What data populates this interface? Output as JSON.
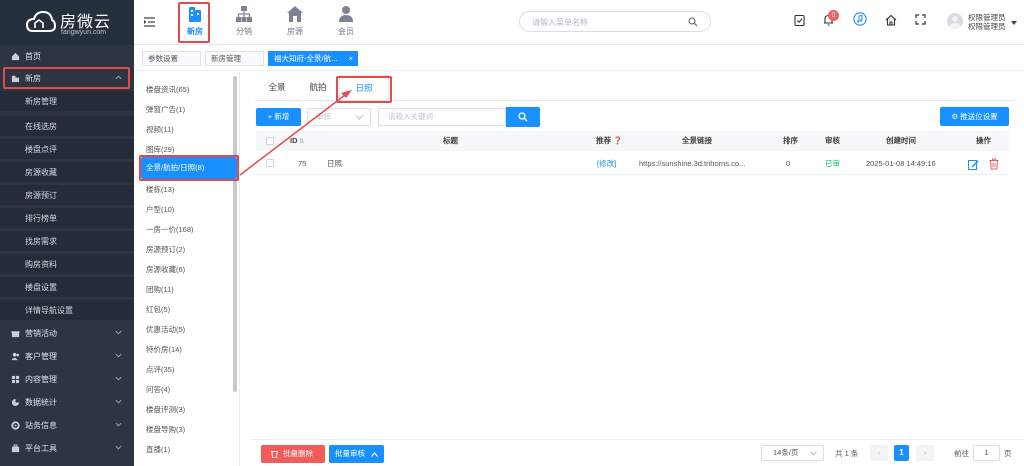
{
  "brand": {
    "name": "房微云",
    "domain": "fangwyun.com"
  },
  "sidebar": {
    "items": [
      {
        "label": "首页",
        "icon": "home-icon"
      },
      {
        "label": "新房",
        "icon": "building-icon",
        "expanded": true
      },
      {
        "label": "营销活动",
        "icon": "gift-icon"
      },
      {
        "label": "客户管理",
        "icon": "people-icon"
      },
      {
        "label": "内容管理",
        "icon": "grid-icon"
      },
      {
        "label": "数据统计",
        "icon": "chart-icon"
      },
      {
        "label": "站务信息",
        "icon": "gear-icon"
      },
      {
        "label": "平台工具",
        "icon": "toolbox-icon"
      }
    ],
    "subitems": [
      "新房管理",
      "在线选房",
      "楼盘点评",
      "房源收藏",
      "房源预订",
      "排行榜单",
      "找房需求",
      "购房资料",
      "楼盘设置",
      "详情导航设置"
    ]
  },
  "topnav": {
    "items": [
      {
        "label": "新房",
        "icon": "building-icon",
        "active": true
      },
      {
        "label": "分销",
        "icon": "org-chart-icon"
      },
      {
        "label": "房源",
        "icon": "house-icon"
      },
      {
        "label": "会员",
        "icon": "member-icon"
      }
    ],
    "search_placeholder": "请输入菜单名称",
    "notification_count": "0",
    "user": {
      "name": "权限管理员",
      "role": "权限管理员"
    }
  },
  "tags": [
    {
      "label": "参数设置",
      "active": false
    },
    {
      "label": "新房管理",
      "active": false
    },
    {
      "label": "福大知府-全景/航...",
      "active": true
    }
  ],
  "categories": [
    "楼盘资讯(65)",
    "弹窗广告(1)",
    "视频(11)",
    "图库(29)",
    "全景/航拍/日照(8)",
    "楼栋(13)",
    "户型(10)",
    "一房一价(168)",
    "房源预订(2)",
    "房源收藏(6)",
    "团购(11)",
    "红包(5)",
    "优惠活动(5)",
    "特价房(14)",
    "点评(35)",
    "问答(4)",
    "楼盘评测(3)",
    "楼盘导购(3)",
    "直播(1)"
  ],
  "active_category_index": 4,
  "tabs": [
    {
      "label": "全景"
    },
    {
      "label": "航拍"
    },
    {
      "label": "日照",
      "active": true
    }
  ],
  "toolbar": {
    "add_label": "+ 新增",
    "review_placeholder": "审核",
    "keyword_placeholder": "请输入关键词",
    "push_label": "推送位设置"
  },
  "table": {
    "headers": {
      "id": "ID",
      "title": "标题",
      "recommend": "推荐",
      "link": "全景链接",
      "sort": "排序",
      "review": "审核",
      "created": "创建时间",
      "actions": "操作"
    },
    "rows": [
      {
        "id": "75",
        "title": "日照",
        "recommend": "[修改]",
        "link": "https://sunshine.3d.trihorns.co...",
        "sort": "0",
        "review": "已审",
        "created": "2025-01-08 14:49:16"
      }
    ]
  },
  "footer": {
    "batch_delete": "批量删除",
    "batch_review": "批量审核",
    "page_size": "14条/页",
    "total": "共 1 条",
    "current_page": "1",
    "goto_label": "前往",
    "goto_value": "1",
    "page_suffix": "页"
  },
  "colors": {
    "primary": "#1890ff",
    "sidebar": "#2d3543",
    "danger": "#f35a5a",
    "success": "#19be6b",
    "highlight": "#e34a4a"
  }
}
